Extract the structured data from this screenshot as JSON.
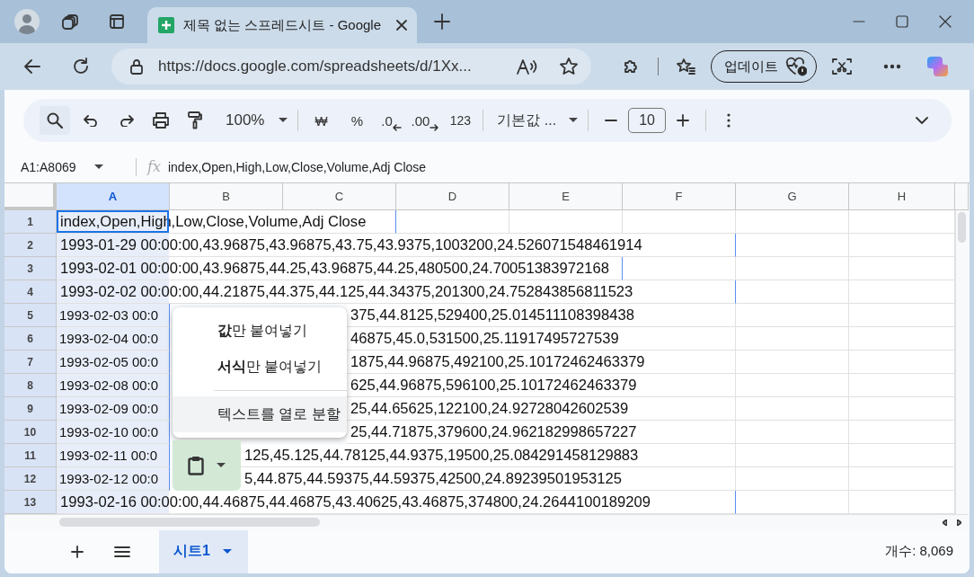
{
  "browser": {
    "tab": {
      "title": "제목 없는 스프레드시트 - Google"
    },
    "address": {
      "url": "https://docs.google.com/spreadsheets/d/1Xx..."
    },
    "update_button": "업데이트"
  },
  "toolbar": {
    "zoom": "100%",
    "currency": "₩",
    "percent": "%",
    "decrease_decimal": ".0",
    "increase_decimal": ".00",
    "number_format": "123",
    "font": "기본값 ...",
    "font_size": "10"
  },
  "formula_bar": {
    "name_box": "A1:A8069",
    "fx": "fx",
    "formula": "index,Open,High,Low,Close,Volume,Adj Close"
  },
  "grid": {
    "columns": [
      {
        "label": "A",
        "selected": true
      },
      {
        "label": "B",
        "selected": false
      },
      {
        "label": "C",
        "selected": false
      },
      {
        "label": "D",
        "selected": false
      },
      {
        "label": "E",
        "selected": false
      },
      {
        "label": "F",
        "selected": false
      },
      {
        "label": "G",
        "selected": false
      },
      {
        "label": "H",
        "selected": false
      }
    ],
    "rows": [
      {
        "header": "1",
        "selected": true,
        "active": true,
        "text": "index,Open,High,Low,Close,Volume,Adj Close"
      },
      {
        "header": "2",
        "selected": true,
        "active": false,
        "text": "1993-01-29 00:00:00,43.96875,43.96875,43.75,43.9375,1003200,24.526071548461914"
      },
      {
        "header": "3",
        "selected": true,
        "active": false,
        "text": "1993-02-01 00:00:00,43.96875,44.25,43.96875,44.25,480500,24.70051383972168"
      },
      {
        "header": "4",
        "selected": true,
        "active": false,
        "text": "1993-02-02 00:00:00,44.21875,44.375,44.125,44.34375,201300,24.752843856811523"
      },
      {
        "header": "5",
        "selected": true,
        "active": false,
        "text_start": "1993-02-03 00:0",
        "text_end": "375,44.8125,529400,25.014511108398438"
      },
      {
        "header": "6",
        "selected": true,
        "active": false,
        "text_start": "1993-02-04 00:0",
        "text_end": "46875,45.0,531500,25.11917495727539"
      },
      {
        "header": "7",
        "selected": true,
        "active": false,
        "text_start": "1993-02-05 00:0",
        "text_end": "1875,44.96875,492100,25.10172462463379"
      },
      {
        "header": "8",
        "selected": true,
        "active": false,
        "text_start": "1993-02-08 00:0",
        "text_end": "625,44.96875,596100,25.10172462463379"
      },
      {
        "header": "9",
        "selected": true,
        "active": false,
        "text_start": "1993-02-09 00:0",
        "text_end": "25,44.65625,122100,24.92728042602539"
      },
      {
        "header": "10",
        "selected": true,
        "active": false,
        "text_start": "1993-02-10 00:0",
        "text_end": "25,44.71875,379600,24.962182998657227"
      },
      {
        "header": "11",
        "selected": true,
        "active": false,
        "text_start": "1993-02-11 00:0",
        "text_end": "125,45.125,44.78125,44.9375,19500,25.084291458129883"
      },
      {
        "header": "12",
        "selected": true,
        "active": false,
        "text_start": "1993-02-12 00:0",
        "text_end": "5,44.875,44.59375,44.59375,42500,24.89239501953125"
      },
      {
        "header": "13",
        "selected": true,
        "active": false,
        "text": "1993-02-16 00:00:00,44.46875,44.46875,43.40625,43.46875,374800,24.2644100189209"
      }
    ]
  },
  "paste_menu": {
    "items": [
      {
        "kind": "option",
        "label": "**값**만 붙여넣기",
        "highlighted": false
      },
      {
        "kind": "option",
        "label": "**서식**만 붙여넣기",
        "highlighted": false
      },
      {
        "kind": "divider"
      },
      {
        "kind": "option",
        "label": "텍스트를 열로 분할",
        "highlighted": true
      }
    ]
  },
  "sheet_tabs": [
    {
      "label": "시트1",
      "selected": true
    }
  ],
  "status": "개수: 8,069"
}
